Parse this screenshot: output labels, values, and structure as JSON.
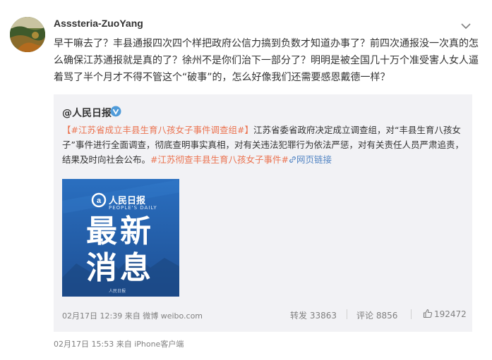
{
  "post": {
    "username": "Asssteria-ZuoYang",
    "text": "早干嘛去了？丰县通报四次四个样把政府公信力搞到负数才知道办事了？前四次通报没一次真的怎么确保江苏通报就是真的了？徐州不是你们治下一部分了？明明是被全国几十万个准受害人女人逼着骂了半个月才不得不管这个“破事”的，怎么好像我们还需要感恩戴德一样？",
    "footer_time": "02月17日 15:53",
    "footer_source": "来自 iPhone客户端"
  },
  "repost": {
    "author": "@人民日报",
    "hashtag": "【#江苏省成立丰县生育八孩女子事件调查组#】",
    "body": "江苏省委省政府决定成立调查组，对“丰县生育八孩女子”事件进行全面调查，彻底查明事实真相，对有关违法犯罪行为依法严惩，对有关责任人员严肃追责，结果及时向社会公布。",
    "hashtag2": "#江苏彻查丰县生育八孩女子事件#",
    "weblink": "网页链接",
    "image": {
      "logo_text": "人民日报",
      "logo_sub": "PEOPLE'S DAILY",
      "big_line1": "最新",
      "big_line2": "消息",
      "bottom_mark": "人民日报"
    },
    "time": "02月17日 12:39",
    "source": "来自 微博 weibo.com",
    "forward_label": "转发 33863",
    "comment_label": "评论 8856",
    "like_count": "192472"
  },
  "colors": {
    "orange_link": "#eb7350",
    "blue_link": "#5486c4",
    "repost_bg": "#f2f2f5"
  }
}
